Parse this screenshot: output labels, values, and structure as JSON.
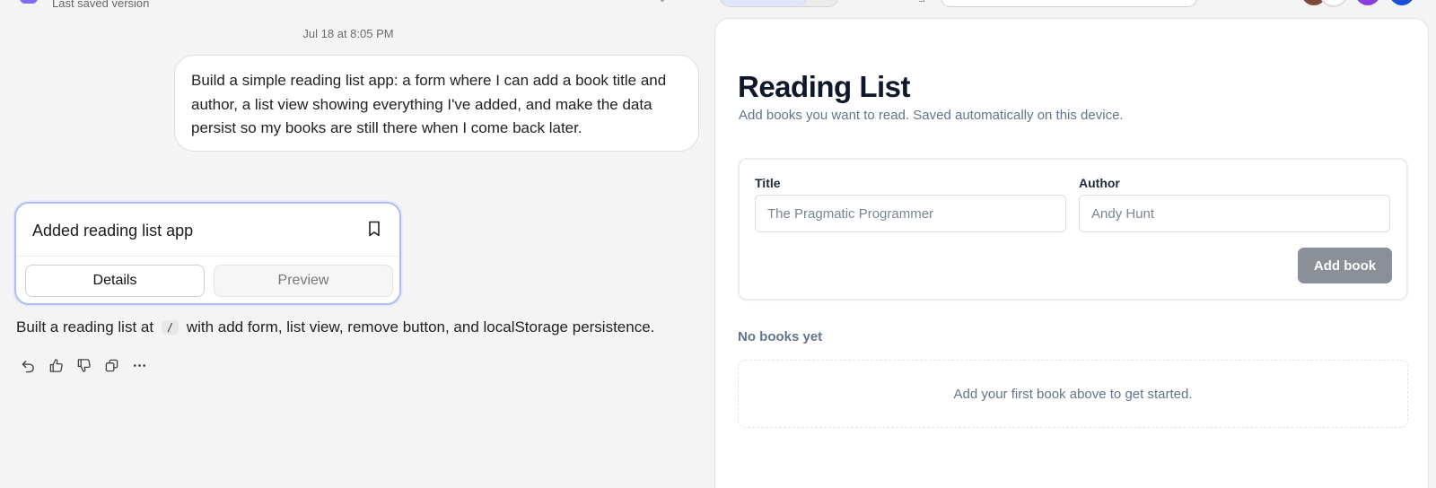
{
  "topbar": {
    "saved_label": "Last saved version"
  },
  "chat": {
    "timestamp": "Jul 18 at 8:05 PM",
    "user_message": "Build a simple reading list app: a form where I can add a book title and author, a list view showing everything I've added, and make the data persist so my books are still there when I come back later.",
    "artifact": {
      "title": "Added reading list app",
      "tabs": [
        "Details",
        "Preview"
      ],
      "active_tab": "Details"
    },
    "summary": {
      "before": "Built a reading list at",
      "code": "/",
      "after": "with add form, list view, remove button, and localStorage persistence."
    },
    "actions": [
      "undo-icon",
      "thumbs-up-icon",
      "thumbs-down-icon",
      "copy-icon",
      "more-icon"
    ]
  },
  "preview": {
    "title": "Reading List",
    "subtitle": "Add books you want to read. Saved automatically on this device.",
    "form": {
      "title_label": "Title",
      "title_placeholder": "The Pragmatic Programmer",
      "author_label": "Author",
      "author_placeholder": "Andy Hunt",
      "submit_label": "Add book"
    },
    "list": {
      "empty_heading": "No books yet",
      "empty_message": "Add your first book above to get started."
    }
  },
  "colors": {
    "accent_border": "#aebdf3",
    "button_disabled": "#8b8f97",
    "muted_text": "#64748b"
  }
}
